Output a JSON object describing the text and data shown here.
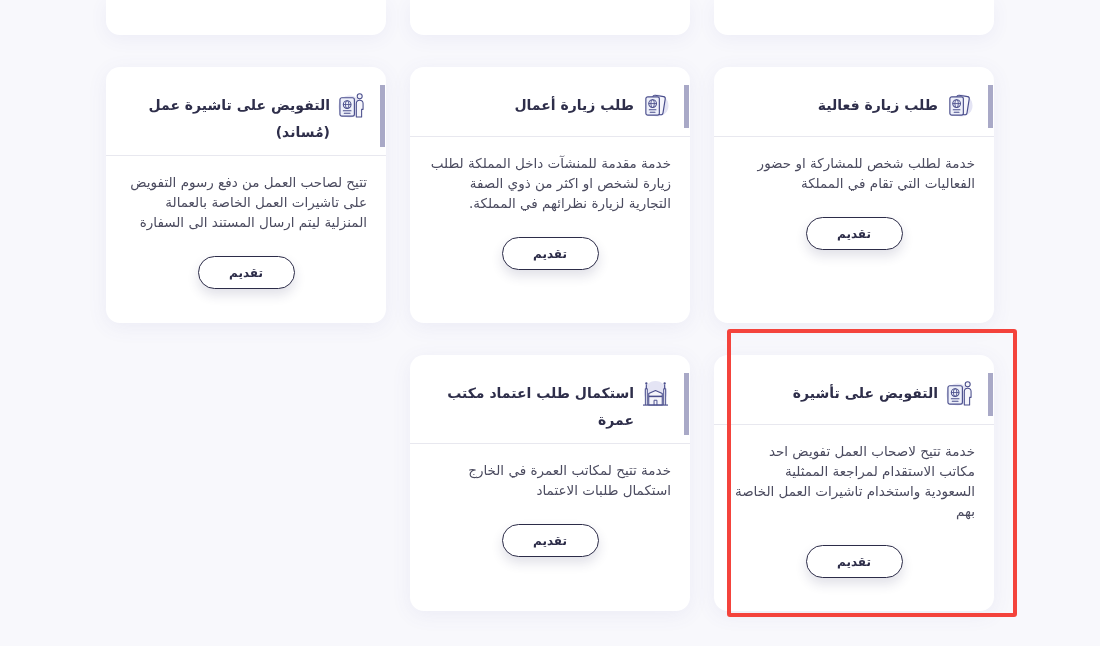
{
  "cards": [
    {
      "kind": "cut_off"
    },
    {
      "kind": "cut_off"
    },
    {
      "kind": "cut_off"
    },
    {
      "kind": "visit",
      "title": "طلب زيارة فعالية",
      "description": "خدمة لطلب شخص للمشاركة او حضور الفعاليات التي تقام في المملكة",
      "button": "تقديم",
      "highlighted": false
    },
    {
      "kind": "visit",
      "title": "طلب زيارة أعمال",
      "description": "خدمة مقدمة للمنشآت داخل المملكة لطلب زيارة لشخص او اكثر من ذوي الصفة التجارية لزيارة نظرائهم في المملكة.",
      "button": "تقديم",
      "highlighted": false
    },
    {
      "kind": "delegation",
      "title": "التفويض على تاشيرة عمل (مُساند)",
      "description": "تتيح لصاحب العمل من دفع رسوم التفويض على تاشيرات العمل الخاصة بالعمالة المنزلية ليتم ارسال المستند الى السفارة",
      "button": "تقديم",
      "highlighted": false
    },
    {
      "kind": "delegation",
      "title": "التفويض على تأشيرة",
      "description": "خدمة تتيح لاصحاب العمل تفويض احد مكاتب الاستقدام لمراجعة الممثلية السعودية واستخدام تاشيرات العمل الخاصة بهم",
      "button": "تقديم",
      "highlighted": true
    },
    {
      "kind": "umrah",
      "title": "استكمال طلب اعتماد مكتب عمرة",
      "description": "خدمة تتيح لمكاتب العمرة في الخارج استكمال طلبات الاعتماد",
      "button": "تقديم",
      "highlighted": false
    }
  ]
}
